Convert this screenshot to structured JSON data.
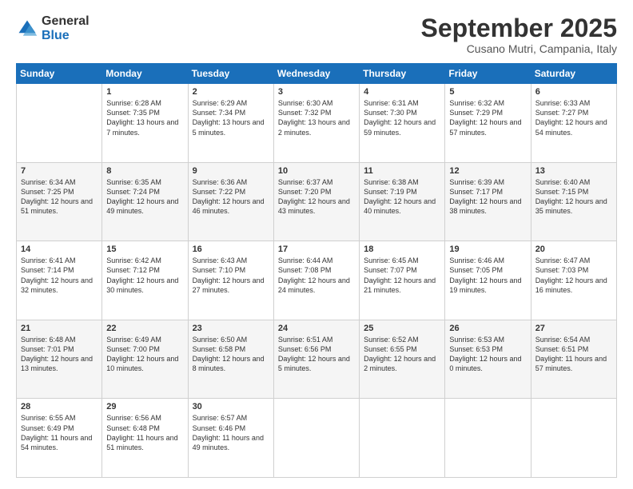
{
  "logo": {
    "general": "General",
    "blue": "Blue"
  },
  "header": {
    "month": "September 2025",
    "location": "Cusano Mutri, Campania, Italy"
  },
  "days": [
    "Sunday",
    "Monday",
    "Tuesday",
    "Wednesday",
    "Thursday",
    "Friday",
    "Saturday"
  ],
  "weeks": [
    [
      {
        "day": "",
        "sunrise": "",
        "sunset": "",
        "daylight": ""
      },
      {
        "day": "1",
        "sunrise": "Sunrise: 6:28 AM",
        "sunset": "Sunset: 7:35 PM",
        "daylight": "Daylight: 13 hours and 7 minutes."
      },
      {
        "day": "2",
        "sunrise": "Sunrise: 6:29 AM",
        "sunset": "Sunset: 7:34 PM",
        "daylight": "Daylight: 13 hours and 5 minutes."
      },
      {
        "day": "3",
        "sunrise": "Sunrise: 6:30 AM",
        "sunset": "Sunset: 7:32 PM",
        "daylight": "Daylight: 13 hours and 2 minutes."
      },
      {
        "day": "4",
        "sunrise": "Sunrise: 6:31 AM",
        "sunset": "Sunset: 7:30 PM",
        "daylight": "Daylight: 12 hours and 59 minutes."
      },
      {
        "day": "5",
        "sunrise": "Sunrise: 6:32 AM",
        "sunset": "Sunset: 7:29 PM",
        "daylight": "Daylight: 12 hours and 57 minutes."
      },
      {
        "day": "6",
        "sunrise": "Sunrise: 6:33 AM",
        "sunset": "Sunset: 7:27 PM",
        "daylight": "Daylight: 12 hours and 54 minutes."
      }
    ],
    [
      {
        "day": "7",
        "sunrise": "Sunrise: 6:34 AM",
        "sunset": "Sunset: 7:25 PM",
        "daylight": "Daylight: 12 hours and 51 minutes."
      },
      {
        "day": "8",
        "sunrise": "Sunrise: 6:35 AM",
        "sunset": "Sunset: 7:24 PM",
        "daylight": "Daylight: 12 hours and 49 minutes."
      },
      {
        "day": "9",
        "sunrise": "Sunrise: 6:36 AM",
        "sunset": "Sunset: 7:22 PM",
        "daylight": "Daylight: 12 hours and 46 minutes."
      },
      {
        "day": "10",
        "sunrise": "Sunrise: 6:37 AM",
        "sunset": "Sunset: 7:20 PM",
        "daylight": "Daylight: 12 hours and 43 minutes."
      },
      {
        "day": "11",
        "sunrise": "Sunrise: 6:38 AM",
        "sunset": "Sunset: 7:19 PM",
        "daylight": "Daylight: 12 hours and 40 minutes."
      },
      {
        "day": "12",
        "sunrise": "Sunrise: 6:39 AM",
        "sunset": "Sunset: 7:17 PM",
        "daylight": "Daylight: 12 hours and 38 minutes."
      },
      {
        "day": "13",
        "sunrise": "Sunrise: 6:40 AM",
        "sunset": "Sunset: 7:15 PM",
        "daylight": "Daylight: 12 hours and 35 minutes."
      }
    ],
    [
      {
        "day": "14",
        "sunrise": "Sunrise: 6:41 AM",
        "sunset": "Sunset: 7:14 PM",
        "daylight": "Daylight: 12 hours and 32 minutes."
      },
      {
        "day": "15",
        "sunrise": "Sunrise: 6:42 AM",
        "sunset": "Sunset: 7:12 PM",
        "daylight": "Daylight: 12 hours and 30 minutes."
      },
      {
        "day": "16",
        "sunrise": "Sunrise: 6:43 AM",
        "sunset": "Sunset: 7:10 PM",
        "daylight": "Daylight: 12 hours and 27 minutes."
      },
      {
        "day": "17",
        "sunrise": "Sunrise: 6:44 AM",
        "sunset": "Sunset: 7:08 PM",
        "daylight": "Daylight: 12 hours and 24 minutes."
      },
      {
        "day": "18",
        "sunrise": "Sunrise: 6:45 AM",
        "sunset": "Sunset: 7:07 PM",
        "daylight": "Daylight: 12 hours and 21 minutes."
      },
      {
        "day": "19",
        "sunrise": "Sunrise: 6:46 AM",
        "sunset": "Sunset: 7:05 PM",
        "daylight": "Daylight: 12 hours and 19 minutes."
      },
      {
        "day": "20",
        "sunrise": "Sunrise: 6:47 AM",
        "sunset": "Sunset: 7:03 PM",
        "daylight": "Daylight: 12 hours and 16 minutes."
      }
    ],
    [
      {
        "day": "21",
        "sunrise": "Sunrise: 6:48 AM",
        "sunset": "Sunset: 7:01 PM",
        "daylight": "Daylight: 12 hours and 13 minutes."
      },
      {
        "day": "22",
        "sunrise": "Sunrise: 6:49 AM",
        "sunset": "Sunset: 7:00 PM",
        "daylight": "Daylight: 12 hours and 10 minutes."
      },
      {
        "day": "23",
        "sunrise": "Sunrise: 6:50 AM",
        "sunset": "Sunset: 6:58 PM",
        "daylight": "Daylight: 12 hours and 8 minutes."
      },
      {
        "day": "24",
        "sunrise": "Sunrise: 6:51 AM",
        "sunset": "Sunset: 6:56 PM",
        "daylight": "Daylight: 12 hours and 5 minutes."
      },
      {
        "day": "25",
        "sunrise": "Sunrise: 6:52 AM",
        "sunset": "Sunset: 6:55 PM",
        "daylight": "Daylight: 12 hours and 2 minutes."
      },
      {
        "day": "26",
        "sunrise": "Sunrise: 6:53 AM",
        "sunset": "Sunset: 6:53 PM",
        "daylight": "Daylight: 12 hours and 0 minutes."
      },
      {
        "day": "27",
        "sunrise": "Sunrise: 6:54 AM",
        "sunset": "Sunset: 6:51 PM",
        "daylight": "Daylight: 11 hours and 57 minutes."
      }
    ],
    [
      {
        "day": "28",
        "sunrise": "Sunrise: 6:55 AM",
        "sunset": "Sunset: 6:49 PM",
        "daylight": "Daylight: 11 hours and 54 minutes."
      },
      {
        "day": "29",
        "sunrise": "Sunrise: 6:56 AM",
        "sunset": "Sunset: 6:48 PM",
        "daylight": "Daylight: 11 hours and 51 minutes."
      },
      {
        "day": "30",
        "sunrise": "Sunrise: 6:57 AM",
        "sunset": "Sunset: 6:46 PM",
        "daylight": "Daylight: 11 hours and 49 minutes."
      },
      {
        "day": "",
        "sunrise": "",
        "sunset": "",
        "daylight": ""
      },
      {
        "day": "",
        "sunrise": "",
        "sunset": "",
        "daylight": ""
      },
      {
        "day": "",
        "sunrise": "",
        "sunset": "",
        "daylight": ""
      },
      {
        "day": "",
        "sunrise": "",
        "sunset": "",
        "daylight": ""
      }
    ]
  ]
}
